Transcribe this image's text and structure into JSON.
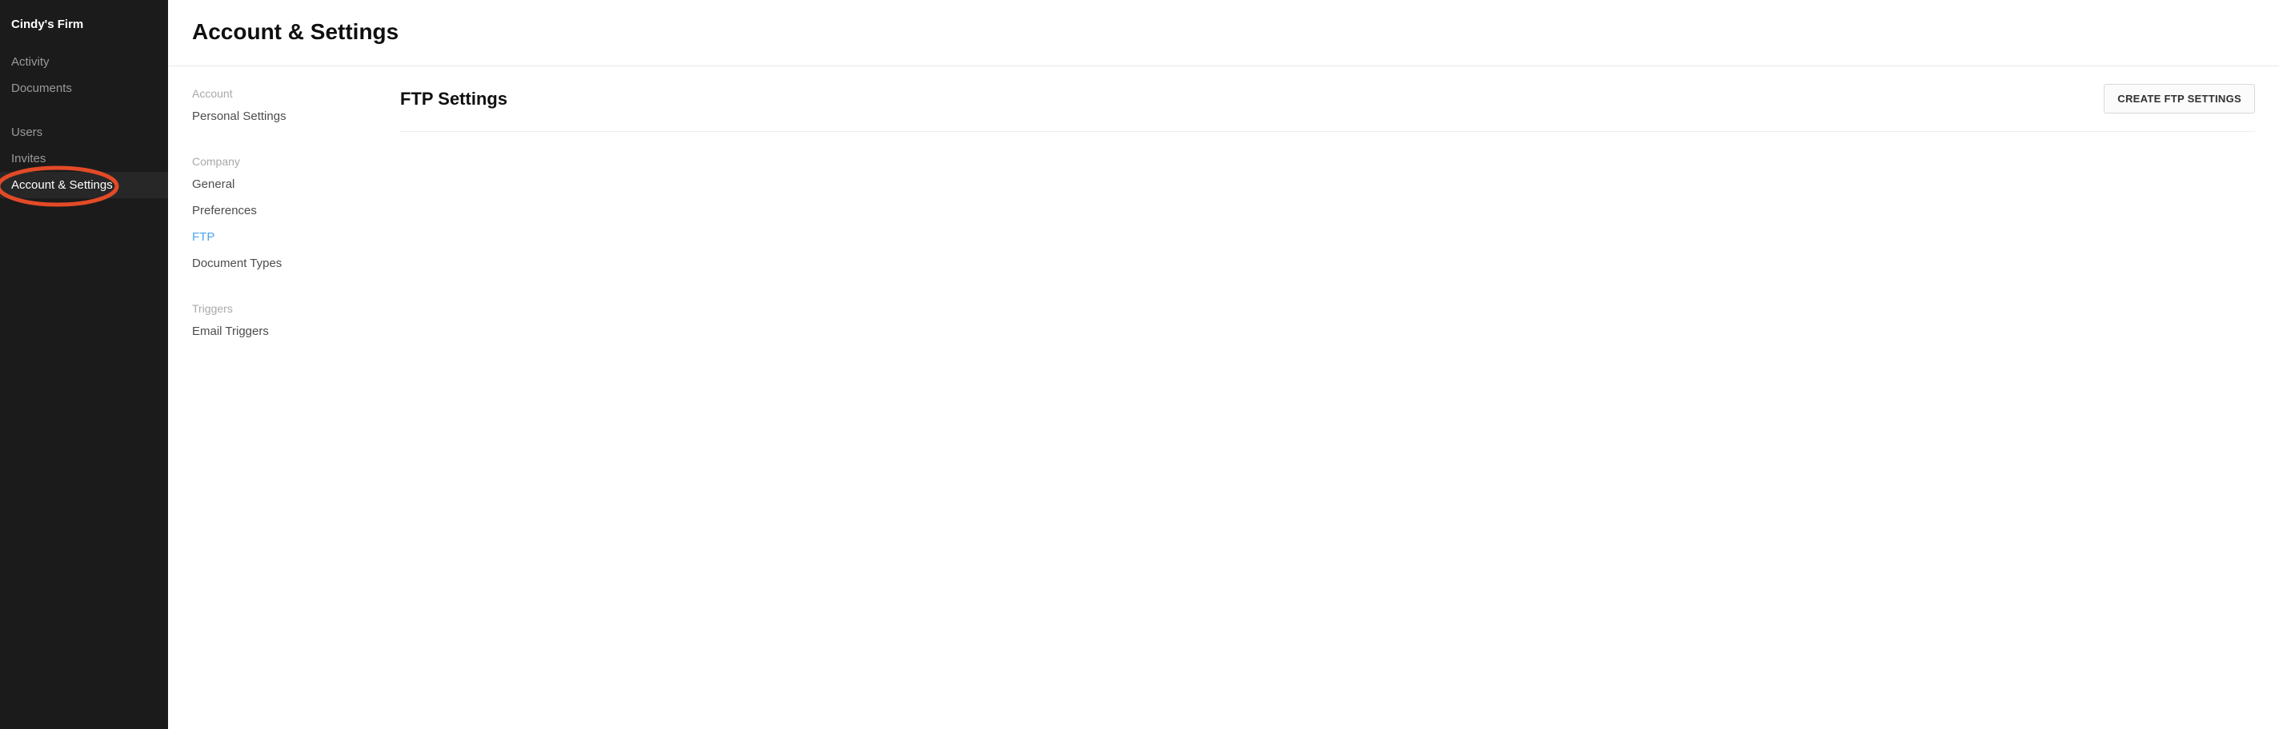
{
  "sidebar": {
    "brand": "Cindy's Firm",
    "items": [
      {
        "label": "Activity"
      },
      {
        "label": "Documents"
      },
      {
        "label": "Users"
      },
      {
        "label": "Invites"
      },
      {
        "label": "Account & Settings"
      }
    ]
  },
  "header": {
    "title": "Account & Settings"
  },
  "subnav": {
    "groups": [
      {
        "label": "Account",
        "items": [
          {
            "label": "Personal Settings"
          }
        ]
      },
      {
        "label": "Company",
        "items": [
          {
            "label": "General"
          },
          {
            "label": "Preferences"
          },
          {
            "label": "FTP"
          },
          {
            "label": "Document Types"
          }
        ]
      },
      {
        "label": "Triggers",
        "items": [
          {
            "label": "Email Triggers"
          }
        ]
      }
    ]
  },
  "panel": {
    "title": "FTP Settings",
    "create_button_label": "CREATE FTP SETTINGS"
  }
}
